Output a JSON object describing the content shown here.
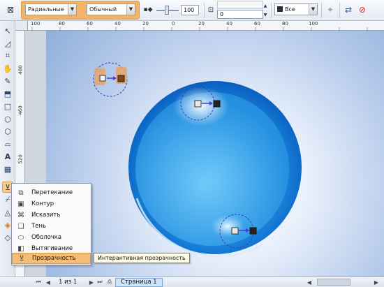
{
  "propbar": {
    "transparency_type": "Радиальные",
    "merge_mode": "Обычный",
    "opacity_value": "100",
    "edge_value": "0",
    "apply_to": "Все"
  },
  "rulers": {
    "h_labels": [
      "100",
      "80",
      "60",
      "40",
      "20",
      "0",
      "20",
      "40",
      "60",
      "80",
      "100"
    ],
    "v_labels": [
      "480",
      "460",
      "520",
      "500"
    ]
  },
  "flyout": {
    "items": [
      {
        "label": "Перетекание",
        "icon": "blend-icon"
      },
      {
        "label": "Контур",
        "icon": "contour-icon"
      },
      {
        "label": "Исказить",
        "icon": "distort-icon"
      },
      {
        "label": "Тень",
        "icon": "drop-shadow-icon"
      },
      {
        "label": "Оболочка",
        "icon": "envelope-icon"
      },
      {
        "label": "Вытягивание",
        "icon": "extrude-icon"
      },
      {
        "label": "Прозрачность",
        "icon": "transparency-icon"
      }
    ]
  },
  "tooltip": "Интерактивная прозрачность",
  "statusbar": {
    "page_count": "1 из 1",
    "page_tab": "Страница 1"
  },
  "colors": {
    "highlight": "#f0b568",
    "sphere_dark": "#0a6fd1",
    "sphere_light": "#5fc0f6",
    "handle_blue": "#4b35e0"
  }
}
